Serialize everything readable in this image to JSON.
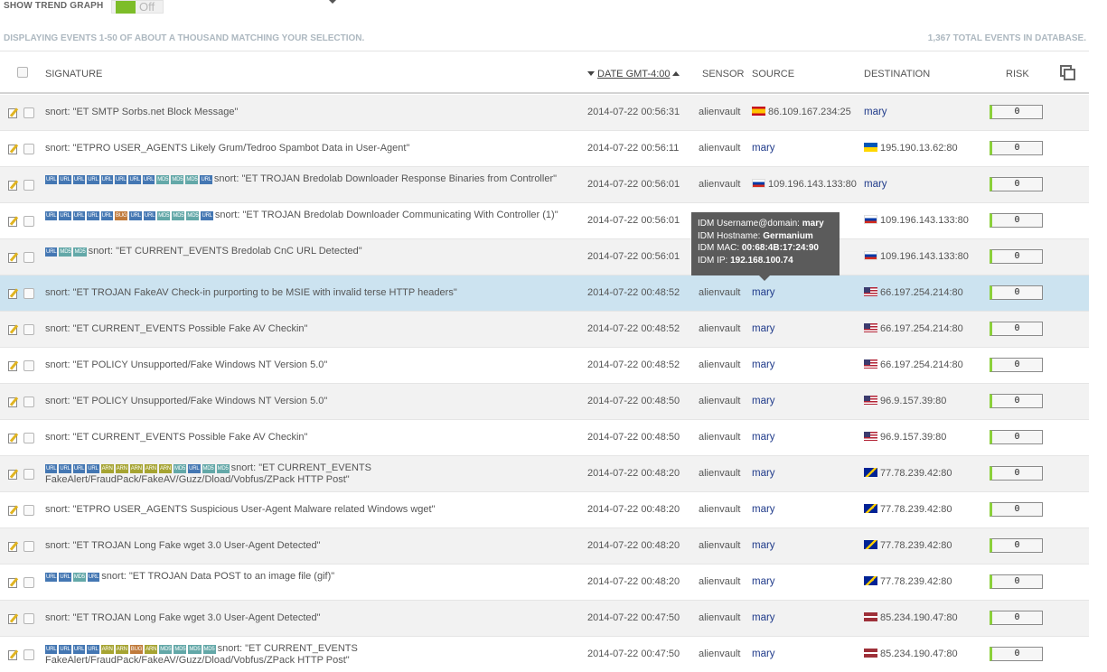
{
  "topbar": {
    "trend_label": "SHOW TREND GRAPH",
    "toggle_state": "Off"
  },
  "info": {
    "displaying": "DISPLAYING EVENTS 1-50 OF ABOUT A THOUSAND MATCHING YOUR SELECTION.",
    "total": "1,367 TOTAL EVENTS IN DATABASE."
  },
  "columns": {
    "signature": "SIGNATURE",
    "date": "DATE GMT-4:00",
    "sensor": "SENSOR",
    "source": "SOURCE",
    "destination": "DESTINATION",
    "risk": "RISK"
  },
  "colors": {
    "selected_row": "#cce3f0",
    "link": "#1f3a8a",
    "risk_bar": "#8bd13a"
  },
  "tooltip": {
    "username_label": "IDM Username@domain:",
    "username": "mary",
    "hostname_label": "IDM Hostname:",
    "hostname": "Germanium",
    "mac_label": "IDM MAC:",
    "mac": "00:68:4B:17:24:90",
    "ip_label": "IDM IP:",
    "ip": "192.168.100.74"
  },
  "events": [
    {
      "badges": [],
      "signature": "snort: \"ET SMTP Sorbs.net Block Message\"",
      "date": "2014-07-22 00:56:31",
      "sensor": "alienvault",
      "source": "86.109.167.234:25",
      "source_flag": "es",
      "source_link": false,
      "destination": "mary",
      "destination_flag": "",
      "destination_link": true,
      "risk": "0"
    },
    {
      "badges": [],
      "signature": "snort: \"ETPRO USER_AGENTS Likely Grum/Tedroo Spambot Data in User-Agent\"",
      "date": "2014-07-22 00:56:11",
      "sensor": "alienvault",
      "source": "mary",
      "source_flag": "",
      "source_link": true,
      "destination": "195.190.13.62:80",
      "destination_flag": "ua",
      "destination_link": false,
      "risk": "0"
    },
    {
      "badges": [
        "URL",
        "URL",
        "URL",
        "URL",
        "URL",
        "URL",
        "URL",
        "URL",
        "MD5",
        "MD5",
        "MD5",
        "URL"
      ],
      "signature": "snort: \"ET TROJAN Bredolab Downloader Response Binaries from Controller\"",
      "date": "2014-07-22 00:56:01",
      "sensor": "alienvault",
      "source": "109.196.143.133:80",
      "source_flag": "ru",
      "source_link": false,
      "destination": "mary",
      "destination_flag": "",
      "destination_link": true,
      "risk": "0"
    },
    {
      "badges": [
        "URL",
        "URL",
        "URL",
        "URL",
        "URL",
        "BUG",
        "URL",
        "URL",
        "MD5",
        "MD5",
        "MD5",
        "URL"
      ],
      "signature": "snort: \"ET TROJAN Bredolab Downloader Communicating With Controller (1)\"",
      "date": "2014-07-22 00:56:01",
      "sensor": "alienvault",
      "source": "",
      "source_flag": "",
      "source_link": true,
      "destination": "109.196.143.133:80",
      "destination_flag": "ru",
      "destination_link": false,
      "risk": "0"
    },
    {
      "badges": [
        "URL",
        "MD5",
        "MD5"
      ],
      "signature": "snort: \"ET CURRENT_EVENTS Bredolab CnC URL Detected\"",
      "date": "2014-07-22 00:56:01",
      "sensor": "alienvault",
      "source": "",
      "source_flag": "",
      "source_link": true,
      "destination": "109.196.143.133:80",
      "destination_flag": "ru",
      "destination_link": false,
      "risk": "0"
    },
    {
      "badges": [],
      "signature": "snort: \"ET TROJAN FakeAV Check-in purporting to be MSIE with invalid terse HTTP headers\"",
      "date": "2014-07-22 00:48:52",
      "sensor": "alienvault",
      "source": "mary",
      "source_flag": "",
      "source_link": true,
      "destination": "66.197.254.214:80",
      "destination_flag": "us",
      "destination_link": false,
      "risk": "0"
    },
    {
      "badges": [],
      "signature": "snort: \"ET CURRENT_EVENTS Possible Fake AV Checkin\"",
      "date": "2014-07-22 00:48:52",
      "sensor": "alienvault",
      "source": "mary",
      "source_flag": "",
      "source_link": true,
      "destination": "66.197.254.214:80",
      "destination_flag": "us",
      "destination_link": false,
      "risk": "0"
    },
    {
      "badges": [],
      "signature": "snort: \"ET POLICY Unsupported/Fake Windows NT Version 5.0\"",
      "date": "2014-07-22 00:48:52",
      "sensor": "alienvault",
      "source": "mary",
      "source_flag": "",
      "source_link": true,
      "destination": "66.197.254.214:80",
      "destination_flag": "us",
      "destination_link": false,
      "risk": "0"
    },
    {
      "badges": [],
      "signature": "snort: \"ET POLICY Unsupported/Fake Windows NT Version 5.0\"",
      "date": "2014-07-22 00:48:50",
      "sensor": "alienvault",
      "source": "mary",
      "source_flag": "",
      "source_link": true,
      "destination": "96.9.157.39:80",
      "destination_flag": "us",
      "destination_link": false,
      "risk": "0"
    },
    {
      "badges": [],
      "signature": "snort: \"ET CURRENT_EVENTS Possible Fake AV Checkin\"",
      "date": "2014-07-22 00:48:50",
      "sensor": "alienvault",
      "source": "mary",
      "source_flag": "",
      "source_link": true,
      "destination": "96.9.157.39:80",
      "destination_flag": "us",
      "destination_link": false,
      "risk": "0"
    },
    {
      "badges": [
        "URL",
        "URL",
        "URL",
        "URL",
        "ARN",
        "ARN",
        "ARN",
        "ARN",
        "ARN",
        "MD5",
        "URL",
        "MD5",
        "MD5"
      ],
      "signature": "snort: \"ET CURRENT_EVENTS FakeAlert/FraudPack/FakeAV/Guzz/Dload/Vobfus/ZPack HTTP Post\"",
      "date": "2014-07-22 00:48:20",
      "sensor": "alienvault",
      "source": "mary",
      "source_flag": "",
      "source_link": true,
      "destination": "77.78.239.42:80",
      "destination_flag": "ba",
      "destination_link": false,
      "risk": "0"
    },
    {
      "badges": [],
      "signature": "snort: \"ETPRO USER_AGENTS Suspicious User-Agent Malware related Windows wget\"",
      "date": "2014-07-22 00:48:20",
      "sensor": "alienvault",
      "source": "mary",
      "source_flag": "",
      "source_link": true,
      "destination": "77.78.239.42:80",
      "destination_flag": "ba",
      "destination_link": false,
      "risk": "0"
    },
    {
      "badges": [],
      "signature": "snort: \"ET TROJAN Long Fake wget 3.0 User-Agent Detected\"",
      "date": "2014-07-22 00:48:20",
      "sensor": "alienvault",
      "source": "mary",
      "source_flag": "",
      "source_link": true,
      "destination": "77.78.239.42:80",
      "destination_flag": "ba",
      "destination_link": false,
      "risk": "0"
    },
    {
      "badges": [
        "URL",
        "URL",
        "MD5",
        "URL"
      ],
      "signature": "snort: \"ET TROJAN Data POST to an image file (gif)\"",
      "date": "2014-07-22 00:48:20",
      "sensor": "alienvault",
      "source": "mary",
      "source_flag": "",
      "source_link": true,
      "destination": "77.78.239.42:80",
      "destination_flag": "ba",
      "destination_link": false,
      "risk": "0"
    },
    {
      "badges": [],
      "signature": "snort: \"ET TROJAN Long Fake wget 3.0 User-Agent Detected\"",
      "date": "2014-07-22 00:47:50",
      "sensor": "alienvault",
      "source": "mary",
      "source_flag": "",
      "source_link": true,
      "destination": "85.234.190.47:80",
      "destination_flag": "lv",
      "destination_link": false,
      "risk": "0"
    },
    {
      "badges": [
        "URL",
        "URL",
        "URL",
        "URL",
        "ARN",
        "ARN",
        "BUG",
        "ARN",
        "MD5",
        "MD5",
        "MD5",
        "MD5"
      ],
      "signature": "snort: \"ET CURRENT_EVENTS FakeAlert/FraudPack/FakeAV/Guzz/Dload/Vobfus/ZPack HTTP Post\"",
      "date": "2014-07-22 00:47:50",
      "sensor": "alienvault",
      "source": "mary",
      "source_flag": "",
      "source_link": true,
      "destination": "85.234.190.47:80",
      "destination_flag": "lv",
      "destination_link": false,
      "risk": "0"
    }
  ]
}
